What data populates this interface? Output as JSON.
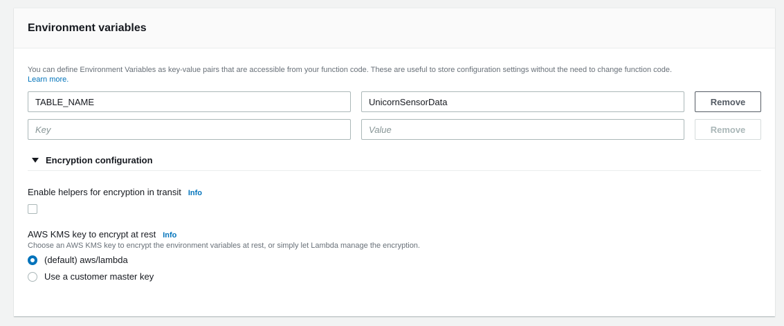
{
  "panel": {
    "title": "Environment variables",
    "description": "You can define Environment Variables as key-value pairs that are accessible from your function code. These are useful to store configuration settings without the need to change function code.",
    "learn_more": "Learn more."
  },
  "variables": [
    {
      "key": "TABLE_NAME",
      "value": "UnicornSensorData",
      "remove_label": "Remove",
      "remove_enabled": true
    },
    {
      "key": "",
      "value": "",
      "key_placeholder": "Key",
      "value_placeholder": "Value",
      "remove_label": "Remove",
      "remove_enabled": false
    }
  ],
  "encryption": {
    "section_title": "Encryption configuration",
    "expanded": true,
    "helpers_label": "Enable helpers for encryption in transit",
    "helpers_info": "Info",
    "helpers_checked": false,
    "kms_label": "AWS KMS key to encrypt at rest",
    "kms_info": "Info",
    "kms_description": "Choose an AWS KMS key to encrypt the environment variables at rest, or simply let Lambda manage the encryption.",
    "options": [
      {
        "label": "(default) aws/lambda",
        "selected": true
      },
      {
        "label": "Use a customer master key",
        "selected": false
      }
    ]
  },
  "colors": {
    "accent": "#0073bb",
    "background": "#f2f3f3",
    "panel_header": "#fafafa"
  }
}
